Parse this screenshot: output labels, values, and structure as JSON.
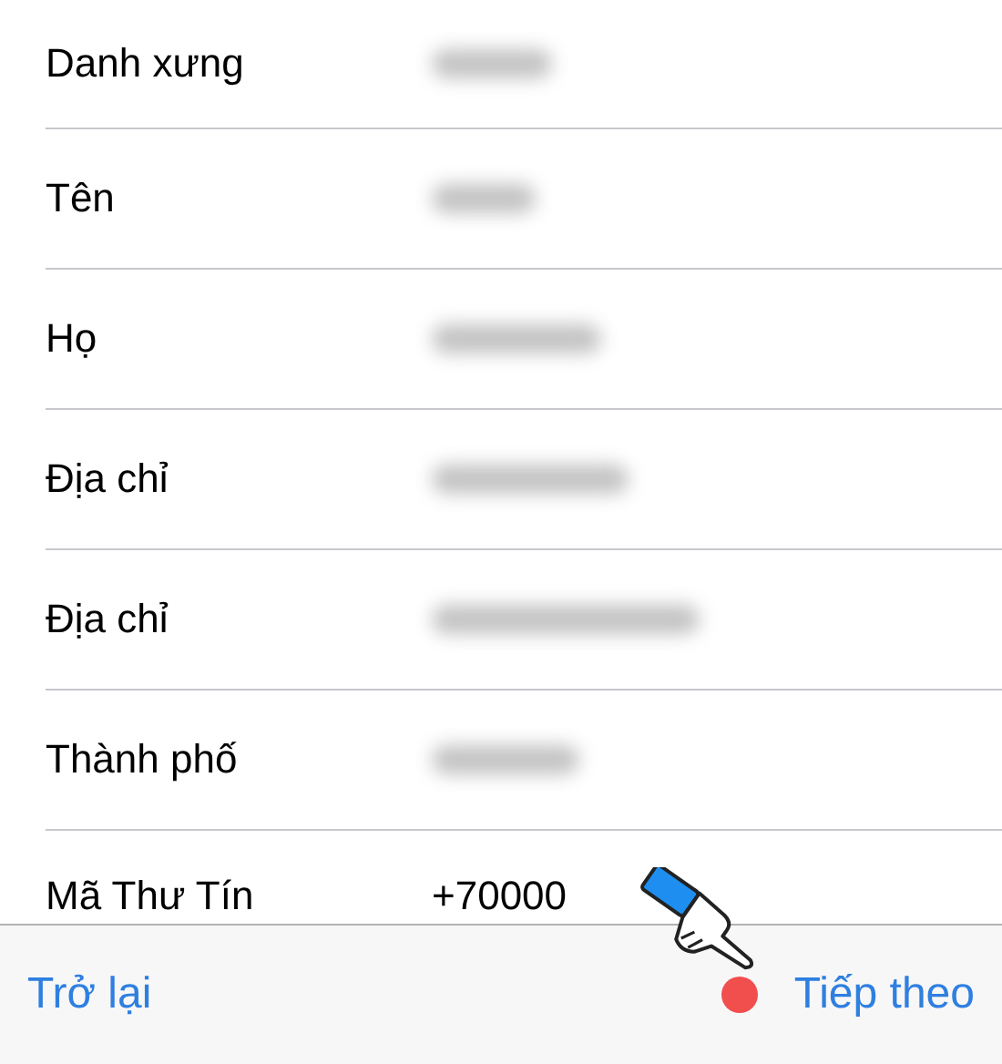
{
  "form": {
    "rows": [
      {
        "label": "Danh xưng",
        "kind": "redacted"
      },
      {
        "label": "Tên",
        "kind": "redacted"
      },
      {
        "label": "Họ",
        "kind": "redacted"
      },
      {
        "label": "Địa chỉ",
        "kind": "redacted"
      },
      {
        "label": "Địa chỉ",
        "kind": "redacted"
      },
      {
        "label": "Thành phố",
        "kind": "redacted"
      },
      {
        "label": "Mã Thư Tín",
        "kind": "text",
        "value": "+70000"
      }
    ]
  },
  "toolbar": {
    "back": "Trở lại",
    "next": "Tiếp theo"
  }
}
